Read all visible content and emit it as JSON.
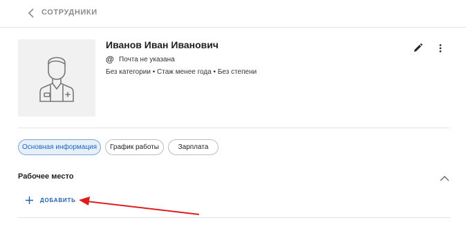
{
  "header": {
    "back_label": "back",
    "breadcrumb": "СОТРУДНИКИ"
  },
  "profile": {
    "name": "Иванов Иван Иванович",
    "email": "Почта не указана",
    "meta": "Без категории • Стаж менее года • Без степени"
  },
  "tabs": [
    {
      "label": "Основная информация",
      "active": true
    },
    {
      "label": "График работы",
      "active": false
    },
    {
      "label": "Зарплата",
      "active": false
    }
  ],
  "section": {
    "title": "Рабочее место",
    "add_label": "ДОБАВИТЬ"
  },
  "colors": {
    "accent": "#1f5fa8",
    "annotation_arrow": "#e01b1b",
    "active_tab_bg": "#e5f0fb"
  },
  "icons": {
    "back": "chevron-left-icon",
    "avatar": "doctor-avatar-icon",
    "email": "at-icon",
    "edit": "pencil-icon",
    "more": "more-vertical-icon",
    "collapse": "chevron-up-icon",
    "add": "plus-icon"
  }
}
